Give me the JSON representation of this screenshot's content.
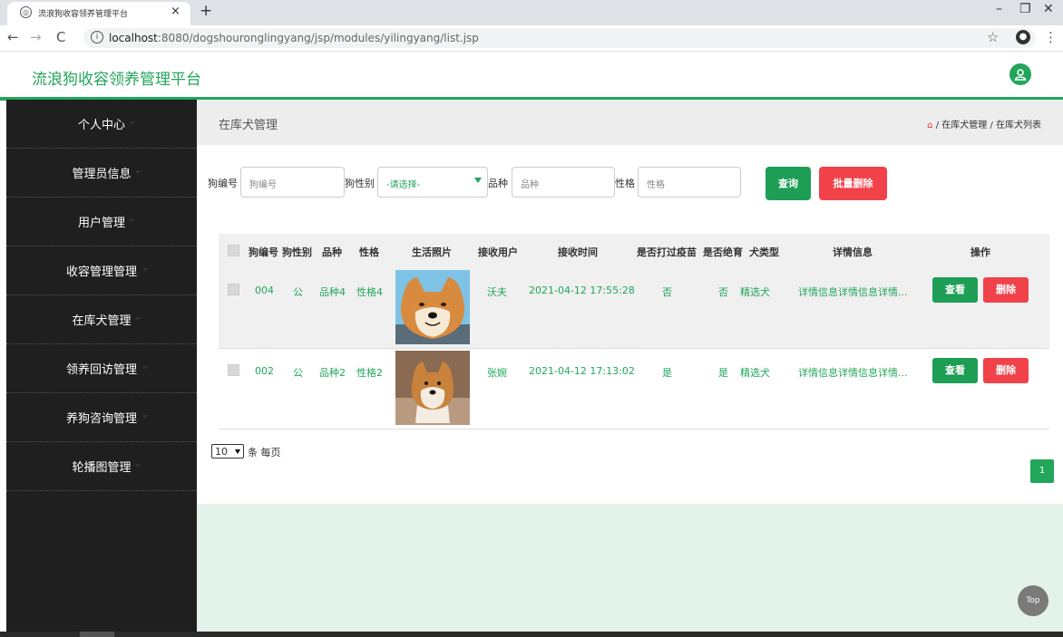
{
  "browser": {
    "tab_title": "流浪狗收容领养管理平台",
    "tab_close": "×",
    "new_tab": "+",
    "url_host": "localhost",
    "url_rest": ":8080/dogshouronglingyang/jsp/modules/yilingyang/list.jsp",
    "window_controls": [
      "–",
      "❐",
      "✕"
    ]
  },
  "header": {
    "app_title": "流浪狗收容领养管理平台",
    "user_icon": "user-icon",
    "accent_color": "#21a65a"
  },
  "sidebar": {
    "items": [
      {
        "label": "个人中心"
      },
      {
        "label": "管理员信息"
      },
      {
        "label": "用户管理"
      },
      {
        "label": "收容管理管理"
      },
      {
        "label": "在库犬管理"
      },
      {
        "label": "领养回访管理"
      },
      {
        "label": "养狗咨询管理"
      },
      {
        "label": "轮播图管理"
      }
    ]
  },
  "page": {
    "title": "在库犬管理",
    "breadcrumb": [
      "在库犬管理",
      "在库犬列表"
    ],
    "breadcrumb_sep": "/"
  },
  "filters": {
    "dog_no_label": "狗编号",
    "dog_no_placeholder": "狗编号",
    "gender_label": "狗性别",
    "gender_value": "-请选择-",
    "breed_label": "品种",
    "breed_placeholder": "品种",
    "character_label": "性格",
    "character_placeholder": "性格",
    "search_button": "查询",
    "batch_delete_button": "批量删除"
  },
  "table": {
    "columns": [
      "狗编号",
      "狗性别",
      "品种",
      "性格",
      "生活照片",
      "接收用户",
      "接收时间",
      "是否打过疫苗",
      "是否绝育",
      "犬类型",
      "详情信息",
      "操作"
    ],
    "rows": [
      {
        "no": "004",
        "gender": "公",
        "breed": "品种4",
        "character": "性格4",
        "user": "沃夫",
        "time": "2021-04-12 17:55:28",
        "vaccinated": "否",
        "neutered": "否",
        "type": "精选犬",
        "detail": "详情信息详情信息详情..."
      },
      {
        "no": "002",
        "gender": "公",
        "breed": "品种2",
        "character": "性格2",
        "user": "张婉",
        "time": "2021-04-12 17:13:02",
        "vaccinated": "是",
        "neutered": "是",
        "type": "精选犬",
        "detail": "详情信息详情信息详情..."
      }
    ],
    "view_button": "查看",
    "delete_button": "删除"
  },
  "pagination": {
    "page_size": "10",
    "per_page_label": "条 每页",
    "current_page": "1"
  },
  "top_button": "Top"
}
